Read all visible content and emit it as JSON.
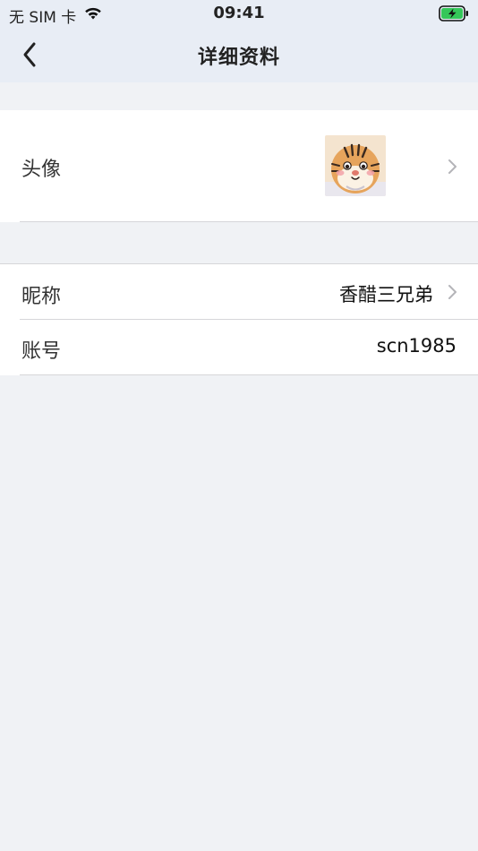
{
  "status_bar": {
    "carrier": "无 SIM 卡",
    "time": "09:41"
  },
  "nav": {
    "title": "详细资料",
    "back_icon": "chevron-left-icon"
  },
  "avatar_row": {
    "label": "头像",
    "avatar_desc": "tiger-cartoon-avatar"
  },
  "nickname_row": {
    "label": "昵称",
    "value": "香醋三兄弟"
  },
  "account_row": {
    "label": "账号",
    "value": "scn1985"
  },
  "colors": {
    "topbar_bg": "#e8edf5",
    "page_bg": "#f0f2f5",
    "battery_green": "#34c759"
  }
}
